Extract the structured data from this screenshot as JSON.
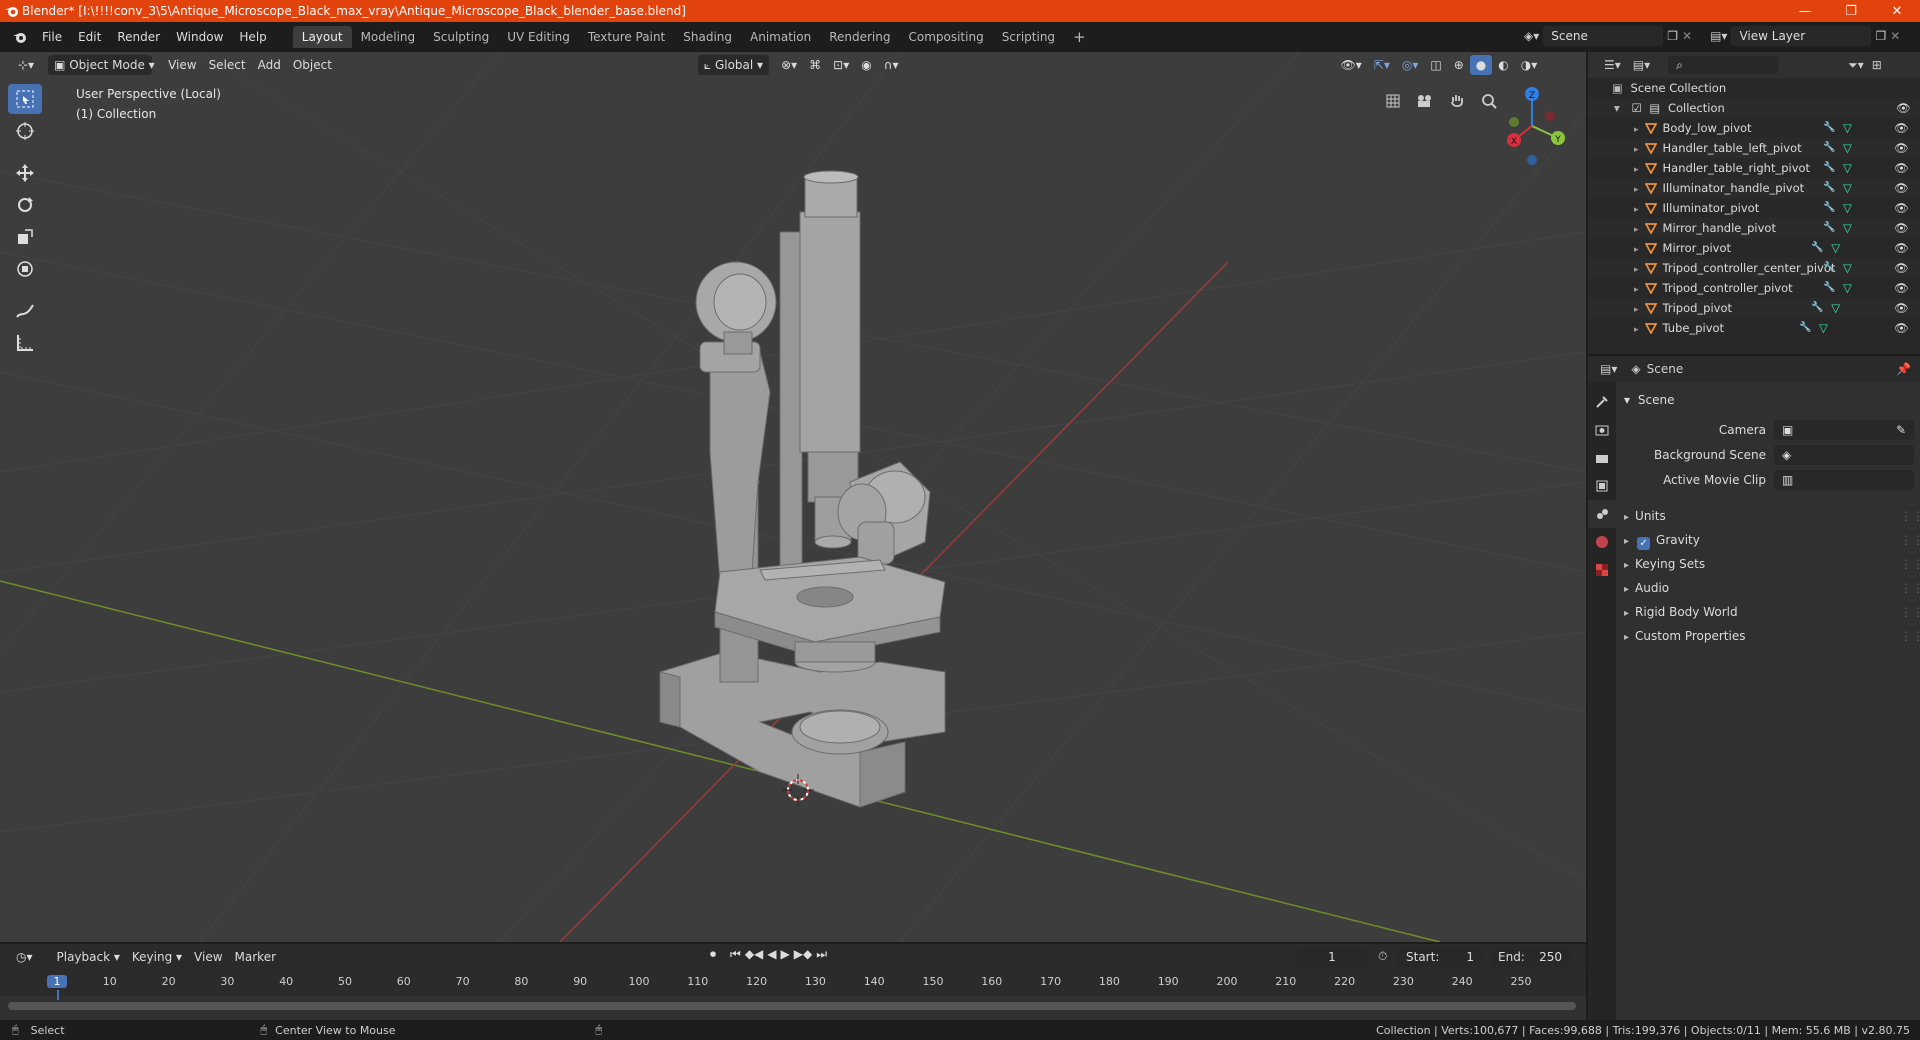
{
  "titlebar": {
    "title": "Blender* [I:\\!!!!conv_3\\5\\Antique_Microscope_Black_max_vray\\Antique_Microscope_Black_blender_base.blend]",
    "minimize": "—",
    "maximize": "❐",
    "close": "✕"
  },
  "menu": {
    "items": [
      "File",
      "Edit",
      "Render",
      "Window",
      "Help"
    ]
  },
  "workspaces": [
    "Layout",
    "Modeling",
    "Sculpting",
    "UV Editing",
    "Texture Paint",
    "Shading",
    "Animation",
    "Rendering",
    "Compositing",
    "Scripting"
  ],
  "topright": {
    "scene": "Scene",
    "view_layer": "View Layer"
  },
  "viewport": {
    "mode": "Object Mode",
    "menus": [
      "View",
      "Select",
      "Add",
      "Object"
    ],
    "transform_orientation": "Global",
    "perspective_label": "User Perspective (Local)",
    "collection_label": "(1) Collection",
    "gizmo": {
      "x": "X",
      "y": "Y",
      "z": "Z"
    }
  },
  "outliner": {
    "search_placeholder": "",
    "scene_collection": "Scene Collection",
    "collection": "Collection",
    "objects": [
      "Body_low_pivot",
      "Handler_table_left_pivot",
      "Handler_table_right_pivot",
      "Illuminator_handle_pivot",
      "Illuminator_pivot",
      "Mirror_handle_pivot",
      "Mirror_pivot",
      "Tripod_controller_center_pivot",
      "Tripod_controller_pivot",
      "Tripod_pivot",
      "Tube_pivot"
    ]
  },
  "properties": {
    "header": "Scene",
    "section": "Scene",
    "camera_label": "Camera",
    "background_scene_label": "Background Scene",
    "active_movie_clip_label": "Active Movie Clip",
    "panels": [
      "Units",
      "Gravity",
      "Keying Sets",
      "Audio",
      "Rigid Body World",
      "Custom Properties"
    ],
    "gravity_checked": true
  },
  "timeline": {
    "menus": [
      "Playback",
      "Keying",
      "View",
      "Marker"
    ],
    "current_frame": "1",
    "start_label": "Start:",
    "start": "1",
    "end_label": "End:",
    "end": "250",
    "ticks": [
      "1",
      "10",
      "20",
      "30",
      "40",
      "50",
      "60",
      "70",
      "80",
      "90",
      "100",
      "110",
      "120",
      "130",
      "140",
      "150",
      "160",
      "170",
      "180",
      "190",
      "200",
      "210",
      "220",
      "230",
      "240",
      "250"
    ]
  },
  "statusbar": {
    "left": "Select",
    "middle": "Center View to Mouse",
    "right": "Collection | Verts:100,677 | Faces:99,688 | Tris:199,376 | Objects:0/11 | Mem: 55.6 MB | v2.80.75"
  },
  "colors": {
    "title_bar": "#e2430d",
    "accent": "#4772b3",
    "mesh_icon": "#e8903c",
    "modifier_icon": "#6aa6ff",
    "data_icon": "#3ee5a6",
    "x_axis": "#d4313d",
    "y_axis": "#8bc53f",
    "z_axis": "#2f7fe5"
  }
}
